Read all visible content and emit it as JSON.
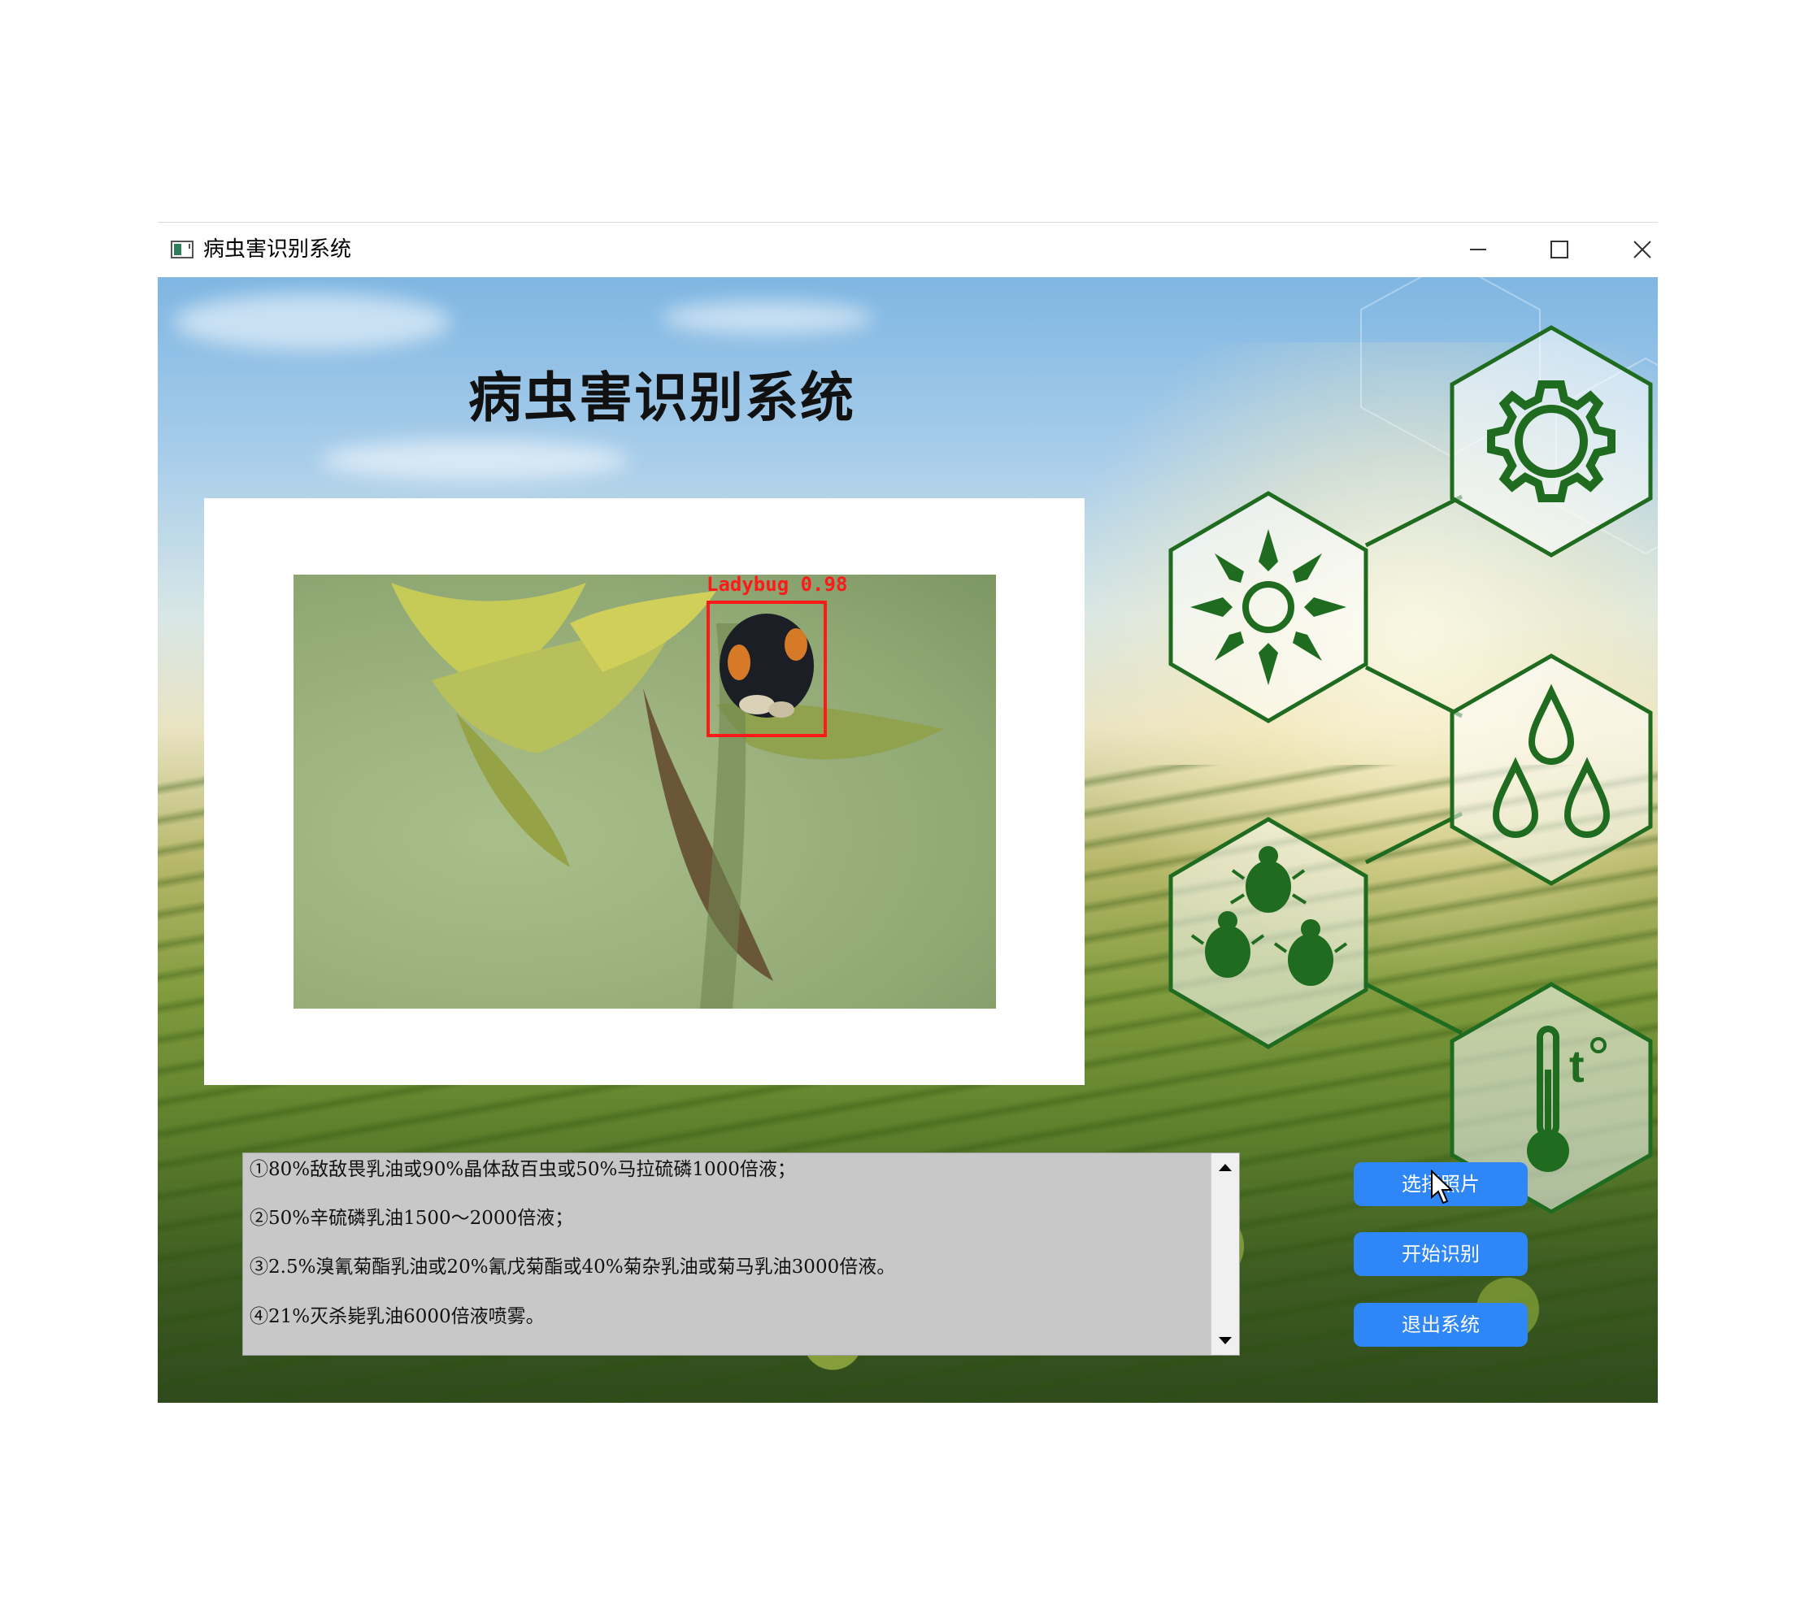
{
  "window": {
    "title": "病虫害识别系统",
    "controls": {
      "minimize": "minimize-icon",
      "maximize": "maximize-icon",
      "close": "close-icon"
    }
  },
  "main": {
    "title": "病虫害识别系统",
    "detection": {
      "label": "Ladybug 0.98",
      "color": "#ff1a1a"
    },
    "info_lines": [
      "①80%敌敌畏乳油或90%晶体敌百虫或50%马拉硫磷1000倍液；",
      "②50%辛硫磷乳油1500～2000倍液；",
      "③2.5%溴氰菊酯乳油或20%氰戊菊酯或40%菊杂乳油或菊马乳油3000倍液。",
      "④21%灭杀毙乳油6000倍液喷雾。"
    ],
    "buttons": {
      "select_photo": "选择照片",
      "start_recognition": "开始识别",
      "exit_system": "退出系统"
    },
    "icons": [
      "gear-icon",
      "sun-icon",
      "water-drops-icon",
      "pests-icon",
      "thermometer-icon"
    ],
    "colors": {
      "button": "#2f86f6",
      "hex_icon": "#1f6b1f"
    }
  }
}
